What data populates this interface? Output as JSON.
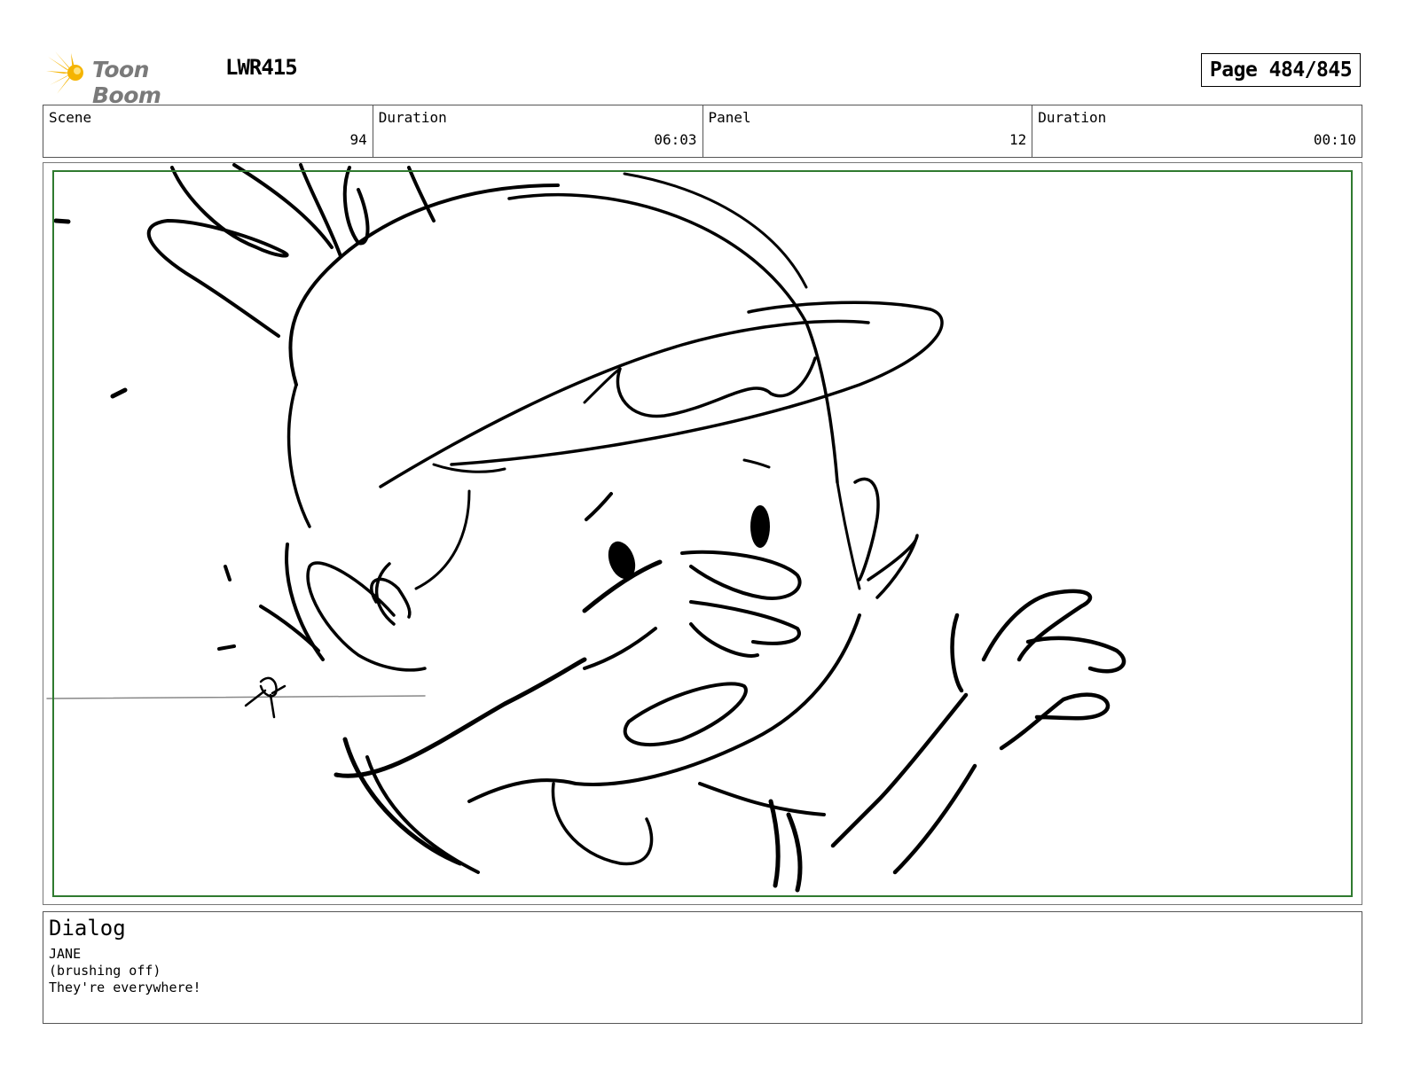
{
  "header": {
    "brand_name": "Toon Boom",
    "project_id": "LWR415",
    "page_indicator": "Page 484/845",
    "brand_color": "#f5b400"
  },
  "info_row": [
    {
      "label": "Scene",
      "value": "94"
    },
    {
      "label": "Duration",
      "value": "06:03"
    },
    {
      "label": "Panel",
      "value": "12"
    },
    {
      "label": "Duration",
      "value": "00:10"
    }
  ],
  "panel": {
    "safe_area_color": "#2f7a2f",
    "stroke_color": "#000000"
  },
  "dialog": {
    "title": "Dialog",
    "character": "JANE",
    "parenthetical": "(brushing off)",
    "line": "They're everywhere!"
  }
}
